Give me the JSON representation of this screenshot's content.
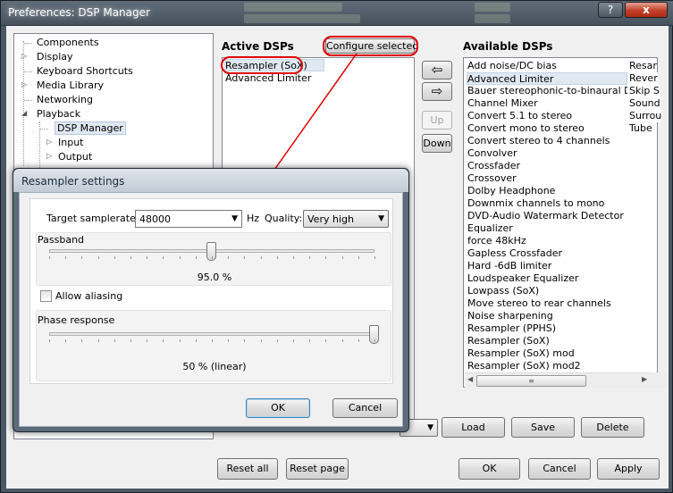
{
  "window": {
    "title": "Preferences: DSP Manager",
    "help_label": "?",
    "close_label": "x"
  },
  "tree": {
    "items": [
      {
        "label": "Components"
      },
      {
        "label": "Display"
      },
      {
        "label": "Keyboard Shortcuts"
      },
      {
        "label": "Media Library"
      },
      {
        "label": "Networking"
      },
      {
        "label": "Playback"
      },
      {
        "label": "DSP Manager"
      },
      {
        "label": "Input"
      },
      {
        "label": "Output"
      }
    ]
  },
  "active": {
    "header": "Active DSPs",
    "configure_label": "Configure selected",
    "items": [
      "Resampler (SoX)",
      "Advanced Limiter"
    ]
  },
  "move": {
    "left_arrow": "⇦",
    "right_arrow": "⇨",
    "up_label": "Up",
    "down_label": "Down"
  },
  "available": {
    "header": "Available DSPs",
    "items": [
      "Add noise/DC bias",
      "Advanced Limiter",
      "Bauer stereophonic-to-binaural DSP",
      "Channel Mixer",
      "Convert 5.1 to stereo",
      "Convert mono to stereo",
      "Convert stereo to 4 channels",
      "Convolver",
      "Crossfader",
      "Crossover",
      "Dolby Headphone",
      "Downmix channels to mono",
      "DVD-Audio Watermark Detector",
      "Equalizer",
      "force 48kHz",
      "Gapless Crossfader",
      "Hard -6dB limiter",
      "Loudspeaker Equalizer",
      "Lowpass (SoX)",
      "Move stereo to rear channels",
      "Noise sharpening",
      "Resampler (PPHS)",
      "Resampler (SoX)",
      "Resampler (SoX) mod",
      "Resampler (SoX) mod2"
    ],
    "second_column": [
      "Resar",
      "Rever",
      "Skip S",
      "Sound",
      "Surrou",
      "Tube"
    ]
  },
  "preset": {
    "load_label": "Load",
    "save_label": "Save",
    "delete_label": "Delete"
  },
  "bottom": {
    "reset_all_label": "Reset all",
    "reset_page_label": "Reset page",
    "ok_label": "OK",
    "cancel_label": "Cancel",
    "apply_label": "Apply"
  },
  "dialog": {
    "title": "Resampler settings",
    "target_label": "Target samplerate:",
    "target_value": "48000",
    "hz_label": "Hz",
    "quality_label": "Quality:",
    "quality_value": "Very high",
    "passband": {
      "label": "Passband",
      "value_text": "95.0 %",
      "level": 0.5
    },
    "allow_aliasing_label": "Allow aliasing",
    "allow_aliasing_checked": false,
    "phase": {
      "label": "Phase response",
      "value_text": "50 % (linear)",
      "level": 1.0
    },
    "ok_label": "OK",
    "cancel_label": "Cancel"
  },
  "colors": {
    "annotation": "#e00000",
    "selection": "#e0e8f2"
  }
}
